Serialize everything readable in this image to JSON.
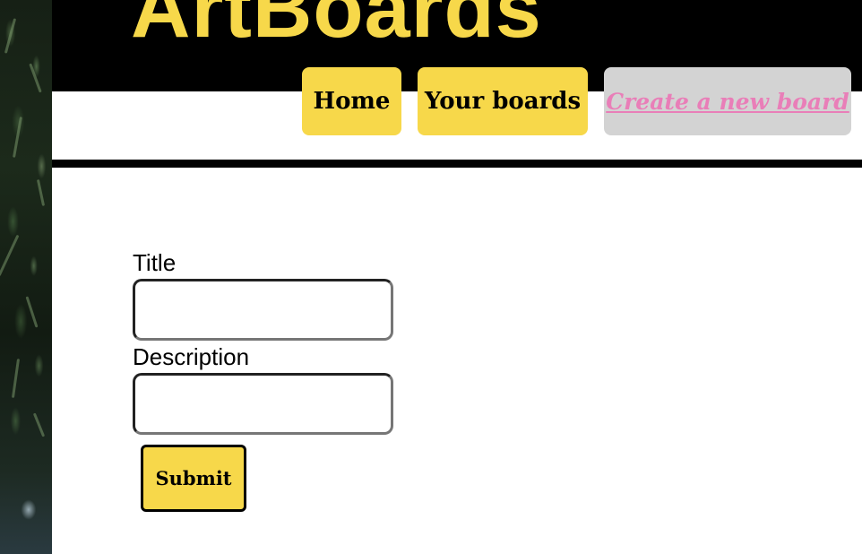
{
  "site": {
    "title": "ArtBoards"
  },
  "nav": {
    "items": [
      {
        "label": "Home",
        "active": false
      },
      {
        "label": "Your boards",
        "active": false
      },
      {
        "label": "Create a new board",
        "active": true
      }
    ]
  },
  "form": {
    "title_label": "Title",
    "title_value": "",
    "description_label": "Description",
    "description_value": "",
    "submit_label": "Submit"
  },
  "colors": {
    "accent_yellow": "#f7d84a",
    "header_black": "#000000",
    "active_link_pink": "#e97eb8",
    "active_tab_gray": "#d3d3d3"
  }
}
